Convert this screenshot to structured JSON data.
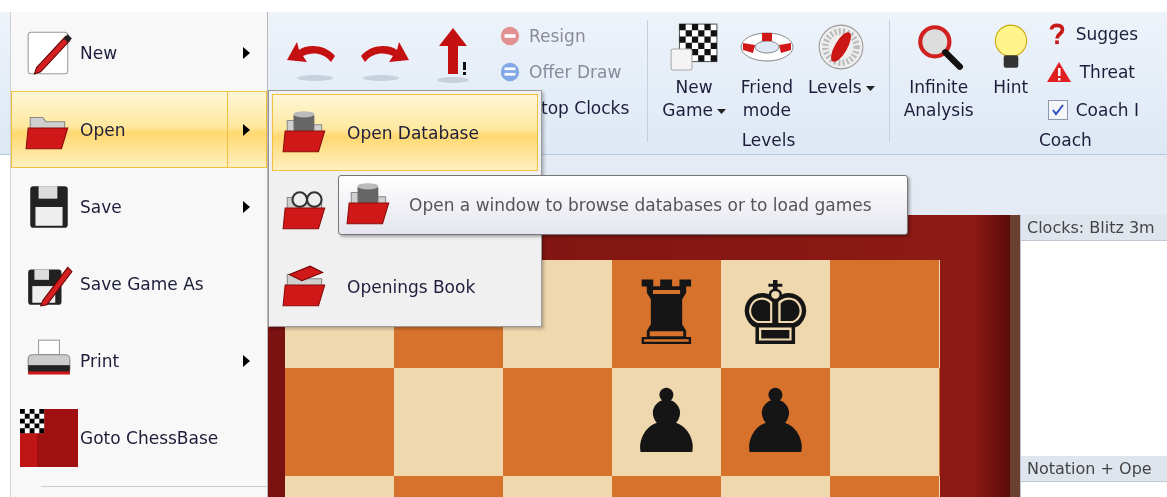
{
  "ribbon": {
    "game_controls": [
      {
        "label": "Resign",
        "disabled": true
      },
      {
        "label": "Offer Draw",
        "disabled": true
      },
      {
        "label": "top Clocks",
        "disabled": false
      }
    ],
    "groups": [
      {
        "label": "Levels",
        "buttons": [
          {
            "kind": "large",
            "label": "New\nGame",
            "dropdown": true
          },
          {
            "kind": "large",
            "label": "Friend\nmode",
            "dropdown": false
          },
          {
            "kind": "large",
            "label": "Levels",
            "dropdown": true
          }
        ]
      },
      {
        "label": "Coach",
        "buttons": [
          {
            "kind": "large",
            "label": "Infinite\nAnalysis",
            "dropdown": false
          },
          {
            "kind": "large",
            "label": "Hint",
            "dropdown": false
          },
          {
            "kind": "small",
            "label": "Sugges"
          },
          {
            "kind": "small",
            "label": "Threat"
          },
          {
            "kind": "check",
            "label": "Coach I",
            "checked": true
          }
        ]
      }
    ]
  },
  "board": {
    "rows": [
      {
        "cells": [
          {},
          {},
          {},
          {
            "piece": "♜"
          },
          {
            "piece": "♚"
          },
          {}
        ]
      },
      {
        "cells": [
          {},
          {},
          {},
          {
            "piece": "♟"
          },
          {
            "piece": "♟"
          },
          {}
        ]
      },
      {
        "cells": [
          {},
          {},
          {},
          {},
          {},
          {}
        ]
      }
    ]
  },
  "side_panel": {
    "panes": [
      {
        "title": "Clocks: Blitz 3m"
      },
      {
        "title": "Notation + Ope"
      }
    ]
  },
  "app_menu": {
    "items": [
      {
        "label": "New",
        "has_submenu": true,
        "selected": false
      },
      {
        "label": "Open",
        "has_submenu": true,
        "selected": true
      },
      {
        "label": "Save",
        "has_submenu": true,
        "selected": false
      },
      {
        "label": "Save Game As",
        "has_submenu": false,
        "selected": false
      },
      {
        "label": "Print",
        "has_submenu": true,
        "selected": false
      },
      {
        "label": "Goto ChessBase",
        "has_submenu": false,
        "selected": false
      }
    ]
  },
  "submenu": {
    "items": [
      {
        "label": "Open Database",
        "selected": true
      },
      {
        "selected": false
      },
      {
        "label": "Openings Book",
        "selected": false
      }
    ]
  },
  "tooltip": {
    "text": "Open a window to browse databases or to load games"
  }
}
